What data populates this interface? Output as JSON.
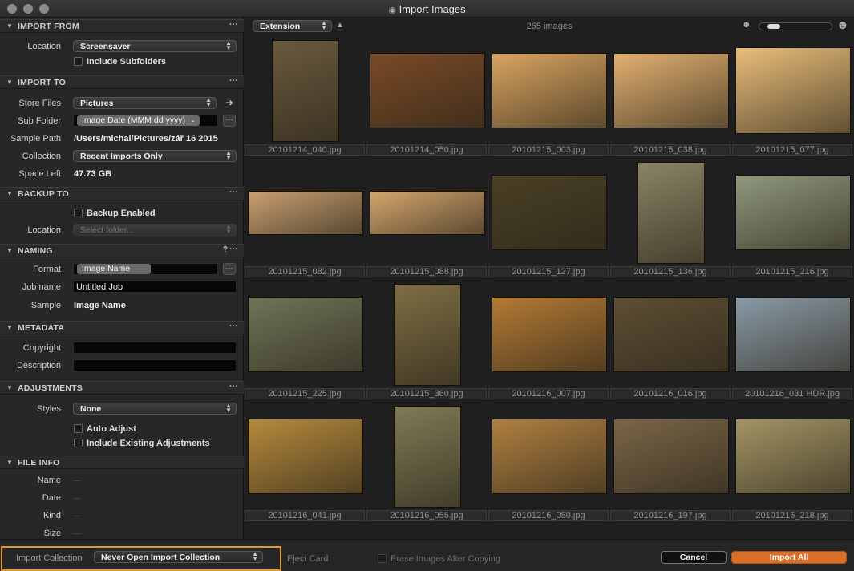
{
  "window": {
    "title": "Import Images"
  },
  "import_from": {
    "header": "IMPORT FROM",
    "location_label": "Location",
    "location_value": "Screensaver",
    "include_subfolders_label": "Include Subfolders"
  },
  "import_to": {
    "header": "IMPORT TO",
    "store_files_label": "Store Files",
    "store_files_value": "Pictures",
    "sub_folder_label": "Sub Folder",
    "sub_folder_value": "Image Date (MMM dd yyyy)",
    "sample_path_label": "Sample Path",
    "sample_path_value": "/Users/michal/Pictures/zář 16 2015",
    "collection_label": "Collection",
    "collection_value": "Recent Imports Only",
    "space_left_label": "Space Left",
    "space_left_value": "47.73 GB"
  },
  "backup_to": {
    "header": "BACKUP TO",
    "backup_enabled_label": "Backup Enabled",
    "location_label": "Location",
    "location_placeholder": "Select folder..."
  },
  "naming": {
    "header": "NAMING",
    "format_label": "Format",
    "format_token": "Image Name",
    "job_name_label": "Job name",
    "job_name_value": "Untitled Job",
    "sample_label": "Sample",
    "sample_value": "Image Name"
  },
  "metadata": {
    "header": "METADATA",
    "copyright_label": "Copyright",
    "description_label": "Description"
  },
  "adjustments": {
    "header": "ADJUSTMENTS",
    "styles_label": "Styles",
    "styles_value": "None",
    "auto_adjust_label": "Auto Adjust",
    "include_existing_label": "Include Existing Adjustments"
  },
  "file_info": {
    "header": "FILE INFO",
    "name_label": "Name",
    "date_label": "Date",
    "kind_label": "Kind",
    "size_label": "Size"
  },
  "browser": {
    "sort_value": "Extension",
    "image_count": "265 images",
    "thumbs": [
      {
        "name": "20101214_040.jpg",
        "color": "#6a5a3e"
      },
      {
        "name": "20101214_050.jpg",
        "color": "#7a4a26"
      },
      {
        "name": "20101215_003.jpg",
        "color": "#d9a460"
      },
      {
        "name": "20101215_038.jpg",
        "color": "#e2b070"
      },
      {
        "name": "20101215_077.jpg",
        "color": "#e9bd79"
      },
      {
        "name": "20101215_082.jpg",
        "color": "#c9a071"
      },
      {
        "name": "20101215_088.jpg",
        "color": "#d5a66d"
      },
      {
        "name": "20101215_127.jpg",
        "color": "#4a4025"
      },
      {
        "name": "20101215_136.jpg",
        "color": "#8a8466"
      },
      {
        "name": "20101215_216.jpg",
        "color": "#8f987e"
      },
      {
        "name": "20101215_225.jpg",
        "color": "#6f7458"
      },
      {
        "name": "20101215_360.jpg",
        "color": "#7e6e44"
      },
      {
        "name": "20101216_007.jpg",
        "color": "#b47a34"
      },
      {
        "name": "20101216_016.jpg",
        "color": "#5e4f34"
      },
      {
        "name": "20101216_031 HDR.jpg",
        "color": "#8a9aa6"
      },
      {
        "name": "20101216_041.jpg",
        "color": "#b68a3c"
      },
      {
        "name": "20101216_055.jpg",
        "color": "#7f7b55"
      },
      {
        "name": "20101216_080.jpg",
        "color": "#b08040"
      },
      {
        "name": "20101216_197.jpg",
        "color": "#7a6547"
      },
      {
        "name": "20101216_218.jpg",
        "color": "#a49565"
      }
    ]
  },
  "footer": {
    "import_collection_label": "Import Collection",
    "import_collection_value": "Never Open Import Collection",
    "eject_card_label": "Eject Card",
    "erase_images_label": "Erase Images After Copying",
    "cancel_label": "Cancel",
    "import_all_label": "Import All"
  },
  "colors": {
    "accent": "#d86f26",
    "highlight_border": "#e09a28"
  }
}
